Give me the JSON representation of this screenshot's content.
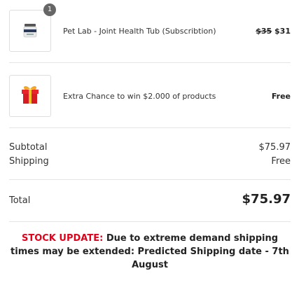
{
  "items": [
    {
      "quantity": "1",
      "name": "Pet Lab - Joint Health Tub (Subscribtion)",
      "price_old": "$35",
      "price_new": "$31",
      "icon": "supplement-tub-icon"
    },
    {
      "name": "Extra Chance to win $2.000 of products",
      "price": "Free",
      "icon": "gift-box-icon"
    }
  ],
  "summary": {
    "subtotal_label": "Subtotal",
    "subtotal_value": "$75.97",
    "shipping_label": "Shipping",
    "shipping_value": "Free",
    "total_label": "Total",
    "total_value": "$75.97"
  },
  "notice": {
    "highlight": "STOCK UPDATE:",
    "text": "Due to extreme demand shipping times may be extended: Predicted Shipping date - 7th August",
    "highlight_color": "#e3001b"
  }
}
